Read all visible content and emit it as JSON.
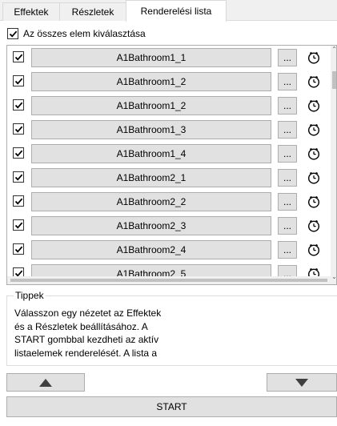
{
  "tabs": [
    {
      "label": "Effektek"
    },
    {
      "label": "Részletek"
    },
    {
      "label": "Renderelési lista"
    }
  ],
  "active_tab": "Renderelési lista",
  "select_all": {
    "label": "Az összes elem kiválasztása",
    "checked": true
  },
  "list": {
    "items": [
      {
        "name": "A1Bathroom1_1",
        "checked": true
      },
      {
        "name": "A1Bathroom1_2",
        "checked": true
      },
      {
        "name": "A1Bathroom1_2",
        "checked": true
      },
      {
        "name": "A1Bathroom1_3",
        "checked": true
      },
      {
        "name": "A1Bathroom1_4",
        "checked": true
      },
      {
        "name": "A1Bathroom2_1",
        "checked": true
      },
      {
        "name": "A1Bathroom2_2",
        "checked": true
      },
      {
        "name": "A1Bathroom2_3",
        "checked": true
      },
      {
        "name": "A1Bathroom2_4",
        "checked": true
      },
      {
        "name": "A1Bathroom2_5",
        "checked": true
      }
    ],
    "options_label": "...",
    "row_icon": "clock-icon"
  },
  "tips": {
    "title": "Tippek",
    "text": "Válasszon egy nézetet az Effektek\nés a Részletek beállításához. A\nSTART gombbal kezdheti az aktív\nlistaelemek renderelését. A lista a"
  },
  "buttons": {
    "up_icon": "triangle-up-icon",
    "down_icon": "triangle-down-icon",
    "start_label": "START"
  }
}
